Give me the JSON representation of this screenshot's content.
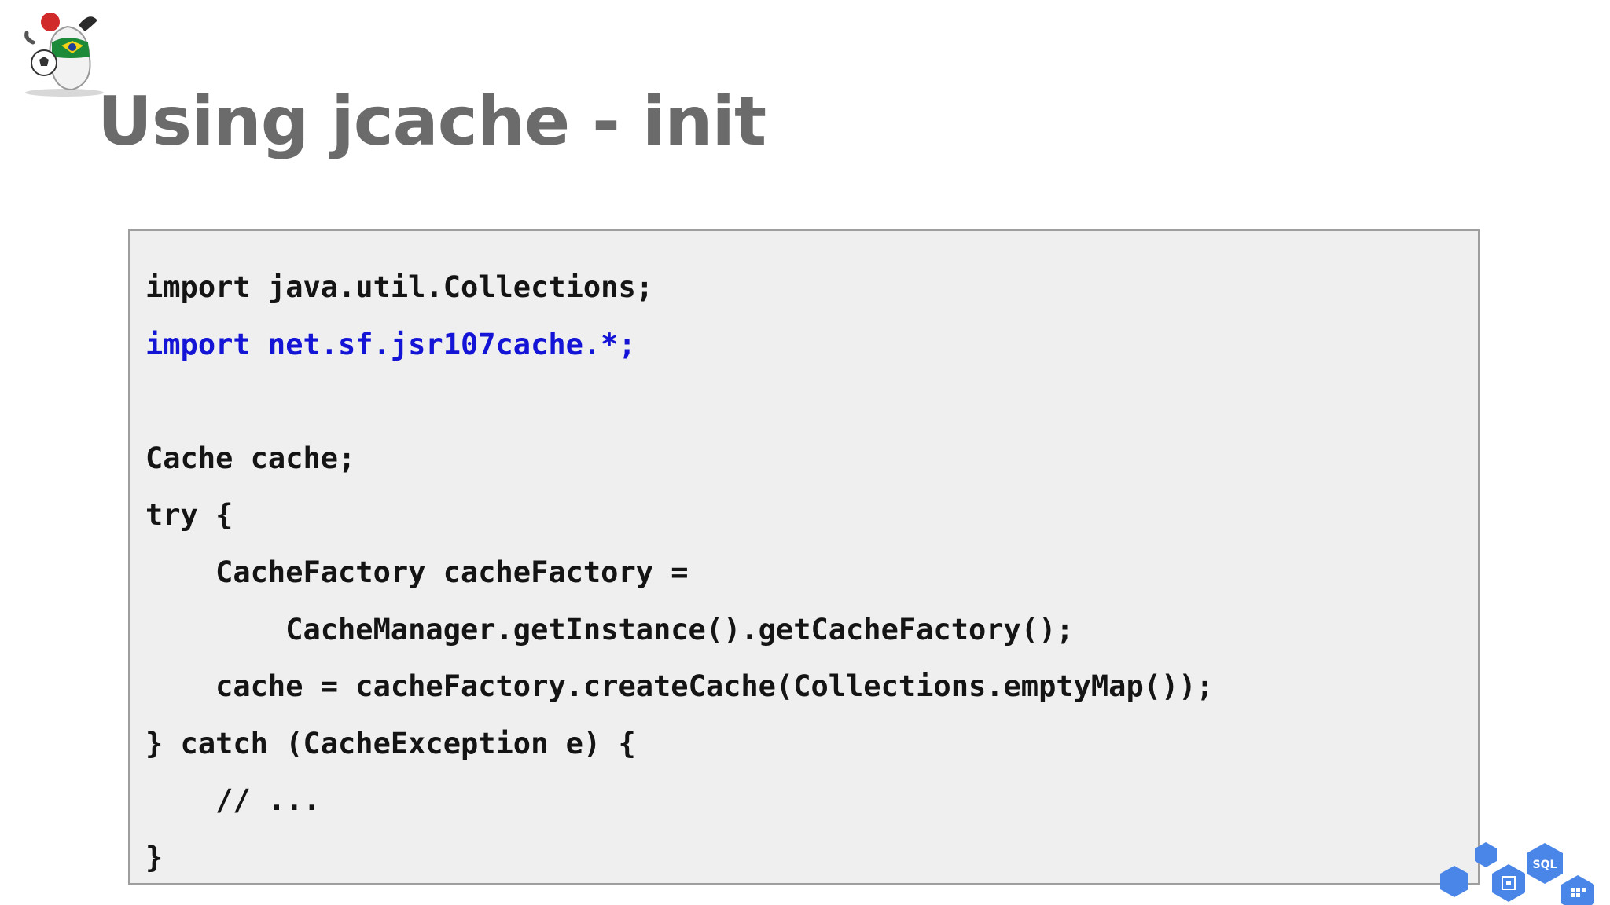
{
  "slide": {
    "title": "Using jcache - init"
  },
  "code": {
    "lines": [
      {
        "text": "import java.util.Collections;"
      },
      {
        "text": "import net.sf.jsr107cache.*;",
        "color": "#1414d6"
      },
      {
        "text": ""
      },
      {
        "text": "Cache cache;"
      },
      {
        "text": "try {"
      },
      {
        "text": "    CacheFactory cacheFactory ="
      },
      {
        "text": "        CacheManager.getInstance().getCacheFactory();"
      },
      {
        "text": "    cache = cacheFactory.createCache(Collections.emptyMap());"
      },
      {
        "text": "} catch (CacheException e) {"
      },
      {
        "text": "    // ..."
      },
      {
        "text": "}"
      }
    ]
  },
  "decoration": {
    "hex_label": "SQL",
    "hex_color": "#4a86e8",
    "mascot_icon": "java-duke-mascot-icon"
  }
}
